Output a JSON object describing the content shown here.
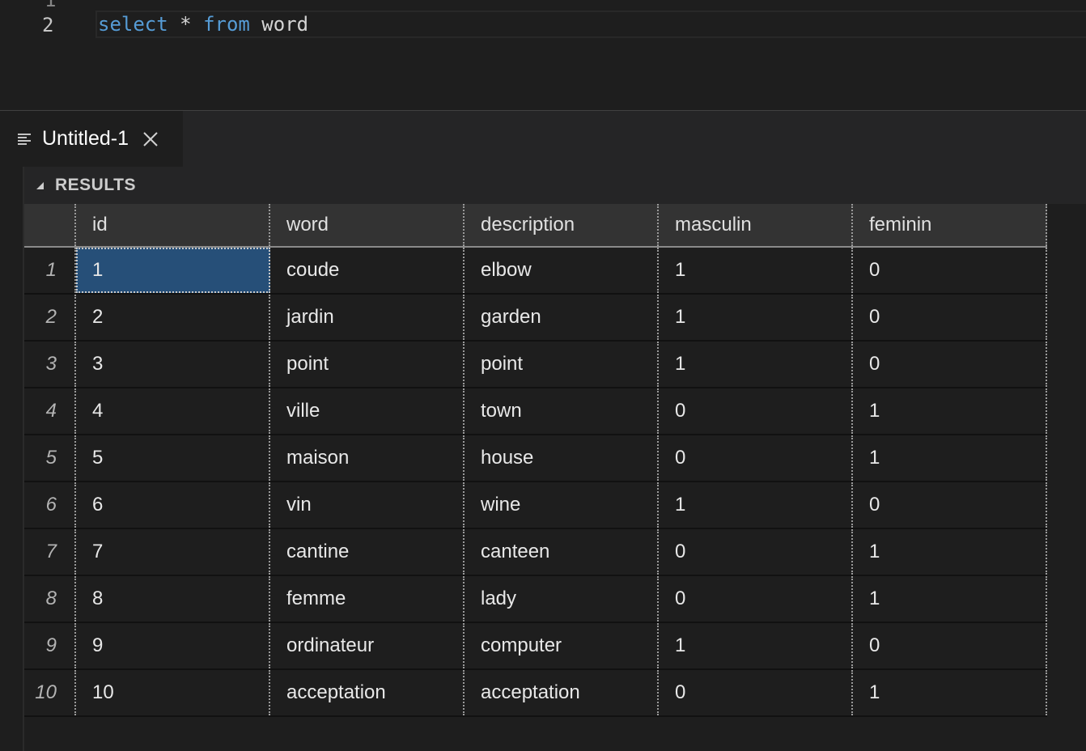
{
  "editor": {
    "partial_line_number": "1",
    "line_number": "2",
    "code": {
      "kw1": "select",
      "rest1": " * ",
      "kw2": "from",
      "rest2": " word"
    }
  },
  "panel": {
    "tab": {
      "label": "Untitled-1",
      "icon": "list-lines-icon",
      "close_icon": "close-icon"
    },
    "results_title": "RESULTS"
  },
  "grid": {
    "columns": [
      "id",
      "word",
      "description",
      "masculin",
      "feminin"
    ],
    "rows": [
      {
        "n": "1",
        "cells": [
          "1",
          "coude",
          "elbow",
          "1",
          "0"
        ]
      },
      {
        "n": "2",
        "cells": [
          "2",
          "jardin",
          "garden",
          "1",
          "0"
        ]
      },
      {
        "n": "3",
        "cells": [
          "3",
          "point",
          "point",
          "1",
          "0"
        ]
      },
      {
        "n": "4",
        "cells": [
          "4",
          "ville",
          "town",
          "0",
          "1"
        ]
      },
      {
        "n": "5",
        "cells": [
          "5",
          "maison",
          "house",
          "0",
          "1"
        ]
      },
      {
        "n": "6",
        "cells": [
          "6",
          "vin",
          "wine",
          "1",
          "0"
        ]
      },
      {
        "n": "7",
        "cells": [
          "7",
          "cantine",
          "canteen",
          "0",
          "1"
        ]
      },
      {
        "n": "8",
        "cells": [
          "8",
          "femme",
          "lady",
          "0",
          "1"
        ]
      },
      {
        "n": "9",
        "cells": [
          "9",
          "ordinateur",
          "computer",
          "1",
          "0"
        ]
      },
      {
        "n": "10",
        "cells": [
          "10",
          "acceptation",
          "acceptation",
          "0",
          "1"
        ]
      }
    ],
    "selected_cell": "row 1, id"
  },
  "colors": {
    "background": "#1e1e1e",
    "keyword": "#569cd6",
    "selection": "#264f78",
    "header_bg": "#333333"
  }
}
